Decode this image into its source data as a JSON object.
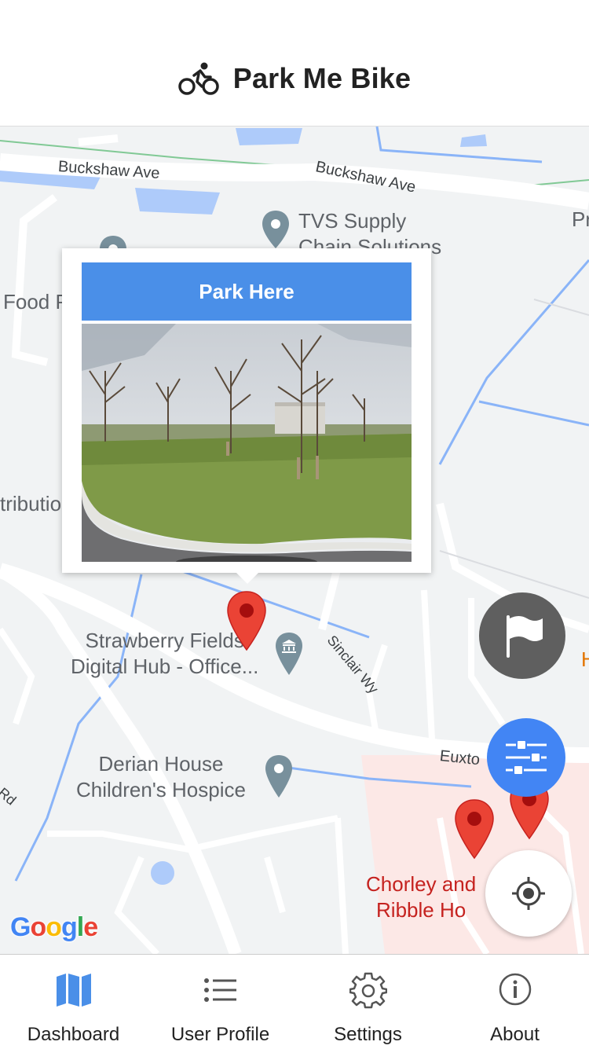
{
  "header": {
    "title": "Park Me Bike",
    "icon": "bike-icon"
  },
  "map": {
    "roads": [
      "Buckshaw Ave",
      "Buckshaw Ave",
      "Sinclair Wy",
      "Euxto",
      "Rd"
    ],
    "places": [
      {
        "line1": "TVS Supply",
        "line2": "Chain Solutions"
      },
      {
        "line1": "Strawberry Fields",
        "line2": "Digital Hub - Office..."
      },
      {
        "line1": "Derian House",
        "line2": "Children's Hospice"
      },
      {
        "line1": "Chorley and",
        "line2": "Ribble Ho"
      }
    ],
    "partial_labels": [
      "Food P",
      "tributio",
      "Pr",
      "H"
    ],
    "attribution": "Google"
  },
  "popup": {
    "button_label": "Park Here",
    "image_alt": "Street view photo"
  },
  "fabs": [
    {
      "icon": "flag-icon",
      "color": "#5f5f5f"
    },
    {
      "icon": "sliders-icon",
      "color": "#4285f4"
    },
    {
      "icon": "crosshair-icon",
      "color": "#ffffff"
    }
  ],
  "tabs": [
    {
      "label": "Dashboard",
      "icon": "map-icon",
      "active": true
    },
    {
      "label": "User Profile",
      "icon": "list-icon",
      "active": false
    },
    {
      "label": "Settings",
      "icon": "gear-icon",
      "active": false
    },
    {
      "label": "About",
      "icon": "info-icon",
      "active": false
    }
  ],
  "colors": {
    "accent": "#4a8fe8",
    "pin": "#ea4335",
    "hospital_area": "#fce8e6"
  }
}
